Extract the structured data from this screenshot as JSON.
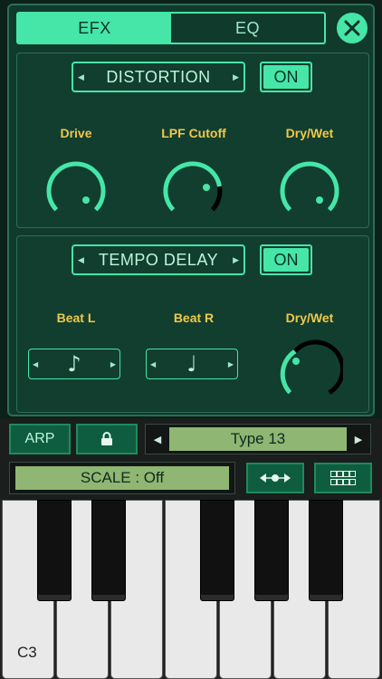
{
  "tabs": [
    {
      "label": "EFX",
      "active": true
    },
    {
      "label": "EQ",
      "active": false
    }
  ],
  "effect1": {
    "name": "DISTORTION",
    "state": "ON",
    "params": [
      "Drive",
      "LPF Cutoff",
      "Dry/Wet"
    ]
  },
  "effect2": {
    "name": "TEMPO DELAY",
    "state": "ON",
    "params": [
      "Beat L",
      "Beat R",
      "Dry/Wet"
    ],
    "beat_l_note": "♪",
    "beat_r_note": "♩"
  },
  "controls": {
    "arp_label": "ARP",
    "type_value": "Type 13",
    "scale_value": "SCALE : Off"
  },
  "keyboard": {
    "first_key_label": "C3"
  },
  "colors": {
    "accent": "#45e6a8",
    "label": "#f0c84a",
    "lcd": "#8fb672"
  },
  "icons": {
    "close": "close-icon",
    "lock": "lock-icon",
    "arrows": "arrows-expand-icon",
    "grid": "grid-icon"
  }
}
